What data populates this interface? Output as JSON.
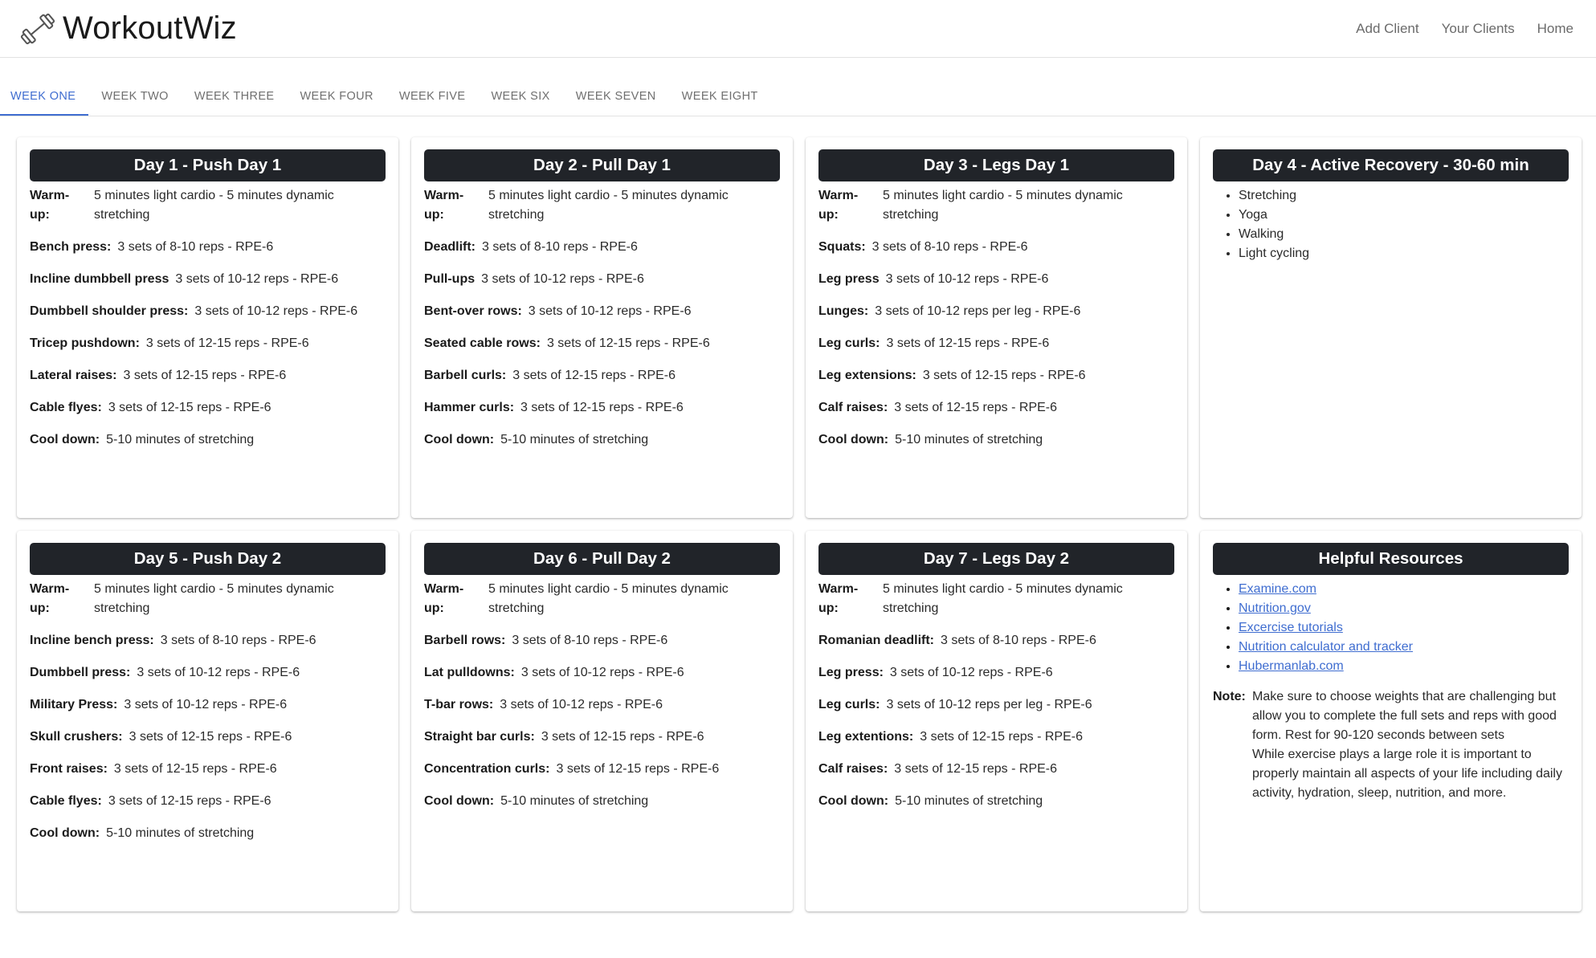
{
  "header": {
    "app_name": "WorkoutWiz",
    "logo_icon": "dumbbell-icon",
    "nav": [
      "Add Client",
      "Your Clients",
      "Home"
    ]
  },
  "tabs": [
    {
      "label": "WEEK ONE",
      "active": true
    },
    {
      "label": "WEEK TWO"
    },
    {
      "label": "WEEK THREE"
    },
    {
      "label": "WEEK FOUR"
    },
    {
      "label": "WEEK FIVE"
    },
    {
      "label": "WEEK SIX"
    },
    {
      "label": "WEEK SEVEN"
    },
    {
      "label": "WEEK EIGHT"
    }
  ],
  "colors": {
    "accent": "#3f6dd0",
    "title_bar": "#212429"
  },
  "days": [
    {
      "title": "Day 1 - Push Day 1",
      "rows": [
        {
          "label": "Warm-up:",
          "value": "5 minutes light cardio - 5 minutes dynamic stretching"
        },
        {
          "label": "Bench press:",
          "value": "3 sets of 8-10 reps - RPE-6"
        },
        {
          "label": "Incline dumbbell press",
          "value": "3 sets of 10-12 reps - RPE-6"
        },
        {
          "label": "Dumbbell shoulder press:",
          "value": "3 sets of 10-12 reps - RPE-6"
        },
        {
          "label": "Tricep pushdown:",
          "value": "3 sets of 12-15 reps - RPE-6"
        },
        {
          "label": "Lateral raises:",
          "value": "3 sets of 12-15 reps - RPE-6"
        },
        {
          "label": "Cable flyes:",
          "value": "3 sets of 12-15 reps - RPE-6"
        },
        {
          "label": "Cool down:",
          "value": "5-10 minutes of stretching"
        }
      ]
    },
    {
      "title": "Day 2 - Pull Day 1",
      "rows": [
        {
          "label": "Warm-up:",
          "value": "5 minutes light cardio - 5 minutes dynamic stretching"
        },
        {
          "label": "Deadlift:",
          "value": "3 sets of 8-10 reps - RPE-6"
        },
        {
          "label": "Pull-ups",
          "value": "3 sets of 10-12 reps - RPE-6"
        },
        {
          "label": "Bent-over rows:",
          "value": "3 sets of 10-12 reps - RPE-6"
        },
        {
          "label": "Seated cable rows:",
          "value": "3 sets of 12-15 reps - RPE-6"
        },
        {
          "label": "Barbell curls:",
          "value": "3 sets of 12-15 reps - RPE-6"
        },
        {
          "label": "Hammer curls:",
          "value": "3 sets of 12-15 reps - RPE-6"
        },
        {
          "label": "Cool down:",
          "value": "5-10 minutes of stretching"
        }
      ]
    },
    {
      "title": "Day 3 - Legs Day 1",
      "rows": [
        {
          "label": "Warm-up:",
          "value": "5 minutes light cardio - 5 minutes dynamic stretching"
        },
        {
          "label": "Squats:",
          "value": "3 sets of 8-10 reps - RPE-6"
        },
        {
          "label": "Leg press",
          "value": "3 sets of 10-12 reps - RPE-6"
        },
        {
          "label": "Lunges:",
          "value": "3 sets of 10-12 reps per leg - RPE-6"
        },
        {
          "label": "Leg curls:",
          "value": "3 sets of 12-15 reps - RPE-6"
        },
        {
          "label": "Leg extensions:",
          "value": "3 sets of 12-15 reps - RPE-6"
        },
        {
          "label": "Calf raises:",
          "value": "3 sets of 12-15 reps - RPE-6"
        },
        {
          "label": "Cool down:",
          "value": "5-10 minutes of stretching"
        }
      ]
    },
    {
      "title": "Day 4 - Active Recovery - 30-60 min",
      "items": [
        "Stretching",
        "Yoga",
        "Walking",
        "Light cycling"
      ]
    },
    {
      "title": "Day 5 - Push Day 2",
      "rows": [
        {
          "label": "Warm-up:",
          "value": "5 minutes light cardio - 5 minutes dynamic stretching"
        },
        {
          "label": "Incline bench press:",
          "value": "3 sets of 8-10 reps - RPE-6"
        },
        {
          "label": "Dumbbell press:",
          "value": "3 sets of 10-12 reps - RPE-6"
        },
        {
          "label": "Military Press:",
          "value": "3 sets of 10-12 reps - RPE-6"
        },
        {
          "label": "Skull crushers:",
          "value": "3 sets of 12-15 reps - RPE-6"
        },
        {
          "label": "Front raises:",
          "value": "3 sets of 12-15 reps - RPE-6"
        },
        {
          "label": "Cable flyes:",
          "value": "3 sets of 12-15 reps - RPE-6"
        },
        {
          "label": "Cool down:",
          "value": "5-10 minutes of stretching"
        }
      ]
    },
    {
      "title": "Day 6 - Pull Day 2",
      "rows": [
        {
          "label": "Warm-up:",
          "value": "5 minutes light cardio - 5 minutes dynamic stretching"
        },
        {
          "label": "Barbell rows:",
          "value": "3 sets of 8-10 reps - RPE-6"
        },
        {
          "label": "Lat pulldowns:",
          "value": "3 sets of 10-12 reps - RPE-6"
        },
        {
          "label": "T-bar rows:",
          "value": "3 sets of 10-12 reps - RPE-6"
        },
        {
          "label": "Straight bar curls:",
          "value": "3 sets of 12-15 reps - RPE-6"
        },
        {
          "label": "Concentration curls:",
          "value": "3 sets of 12-15 reps - RPE-6"
        },
        {
          "label": "Cool down:",
          "value": "5-10 minutes of stretching"
        }
      ]
    },
    {
      "title": "Day 7 - Legs Day 2",
      "rows": [
        {
          "label": "Warm-up:",
          "value": "5 minutes light cardio - 5 minutes dynamic stretching"
        },
        {
          "label": "Romanian deadlift:",
          "value": "3 sets of 8-10 reps - RPE-6"
        },
        {
          "label": "Leg press:",
          "value": "3 sets of 10-12 reps - RPE-6"
        },
        {
          "label": "Leg curls:",
          "value": "3 sets of 10-12 reps per leg - RPE-6"
        },
        {
          "label": "Leg extentions:",
          "value": "3 sets of 12-15 reps - RPE-6"
        },
        {
          "label": "Calf raises:",
          "value": "3 sets of 12-15 reps - RPE-6"
        },
        {
          "label": "Cool down:",
          "value": "5-10 minutes of stretching"
        }
      ]
    }
  ],
  "resources": {
    "title": "Helpful Resources",
    "links": [
      "Examine.com",
      "Nutrition.gov",
      "Excercise tutorials",
      "Nutrition calculator and tracker",
      "Hubermanlab.com"
    ],
    "note_label": "Note:",
    "note_lines": [
      "Make sure to choose weights that are challenging but allow you to complete the full sets and reps with good form. Rest for 90-120 seconds between sets",
      "While exercise plays a large role it is important to properly maintain all aspects of your life including daily activity, hydration, sleep, nutrition, and more."
    ]
  }
}
